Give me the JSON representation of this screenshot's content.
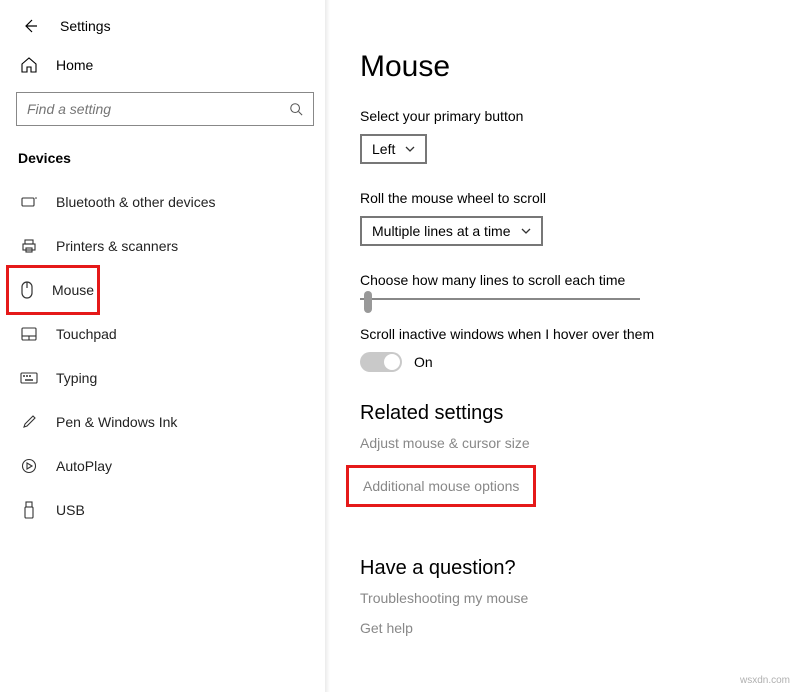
{
  "app_title": "Settings",
  "home_label": "Home",
  "search_placeholder": "Find a setting",
  "category": "Devices",
  "nav": [
    {
      "label": "Bluetooth & other devices"
    },
    {
      "label": "Printers & scanners"
    },
    {
      "label": "Mouse"
    },
    {
      "label": "Touchpad"
    },
    {
      "label": "Typing"
    },
    {
      "label": "Pen & Windows Ink"
    },
    {
      "label": "AutoPlay"
    },
    {
      "label": "USB"
    }
  ],
  "page_title": "Mouse",
  "primary_button": {
    "label": "Select your primary button",
    "value": "Left"
  },
  "scroll_wheel": {
    "label": "Roll the mouse wheel to scroll",
    "value": "Multiple lines at a time"
  },
  "scroll_lines": {
    "label": "Choose how many lines to scroll each time"
  },
  "inactive_windows": {
    "label": "Scroll inactive windows when I hover over them",
    "value": "On"
  },
  "related": {
    "heading": "Related settings",
    "links": [
      "Adjust mouse & cursor size",
      "Additional mouse options"
    ]
  },
  "question": {
    "heading": "Have a question?",
    "links": [
      "Troubleshooting my mouse",
      "Get help"
    ]
  },
  "watermark": "wsxdn.com"
}
